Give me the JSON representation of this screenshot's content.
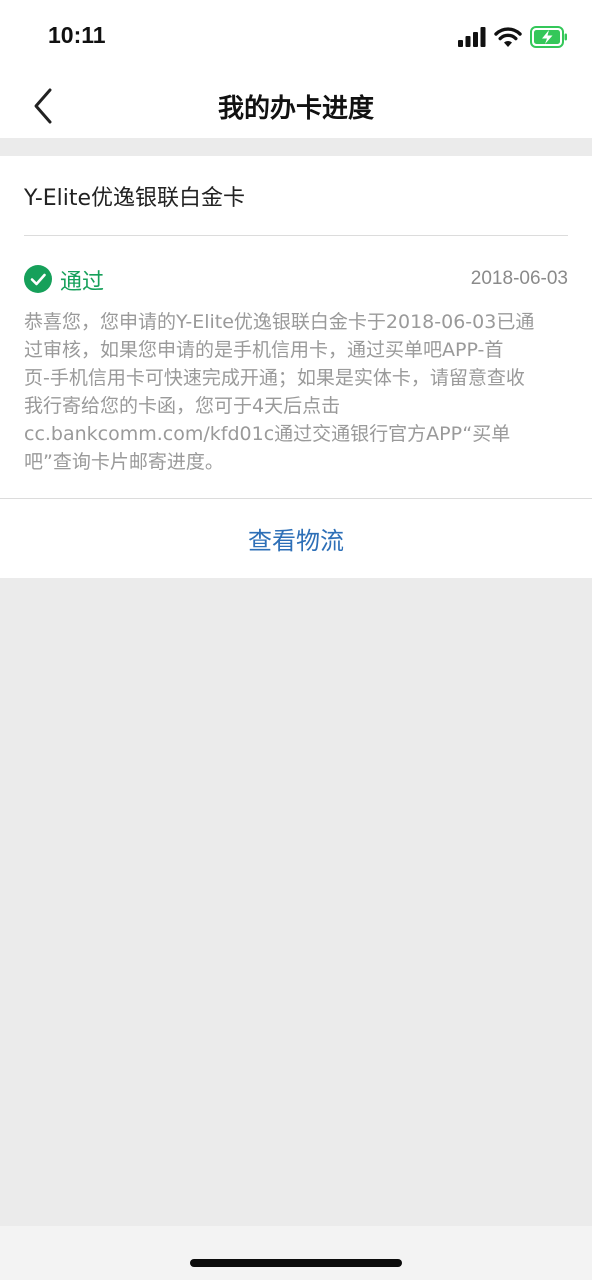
{
  "status_bar": {
    "time": "10:11"
  },
  "nav": {
    "title": "我的办卡进度"
  },
  "card": {
    "name": "Y-Elite优逸银联白金卡",
    "status": "通过",
    "date": "2018-06-03",
    "description_lines": [
      "恭喜您，您申请的Y-Elite优逸银联白金卡于2018-06-03已通",
      "过审核，如果您申请的是手机信用卡，通过买单吧APP-首",
      "页-手机信用卡可快速完成开通；如果是实体卡，请留意查收",
      "我行寄给您的卡函，您可于4天后点击",
      "cc.bankcomm.com/kfd01c通过交通银行官方APP“买单",
      "吧”查询卡片邮寄进度。"
    ],
    "logistics_label": "查看物流"
  },
  "colors": {
    "success": "#16a05a",
    "link": "#2d6fb7",
    "page_bg": "#ebebeb",
    "battery": "#34c759"
  },
  "icons": {
    "back": "chevron-left-icon",
    "status": "check-circle-icon",
    "signal": "signal-icon",
    "wifi": "wifi-icon",
    "battery": "battery-charging-icon"
  }
}
